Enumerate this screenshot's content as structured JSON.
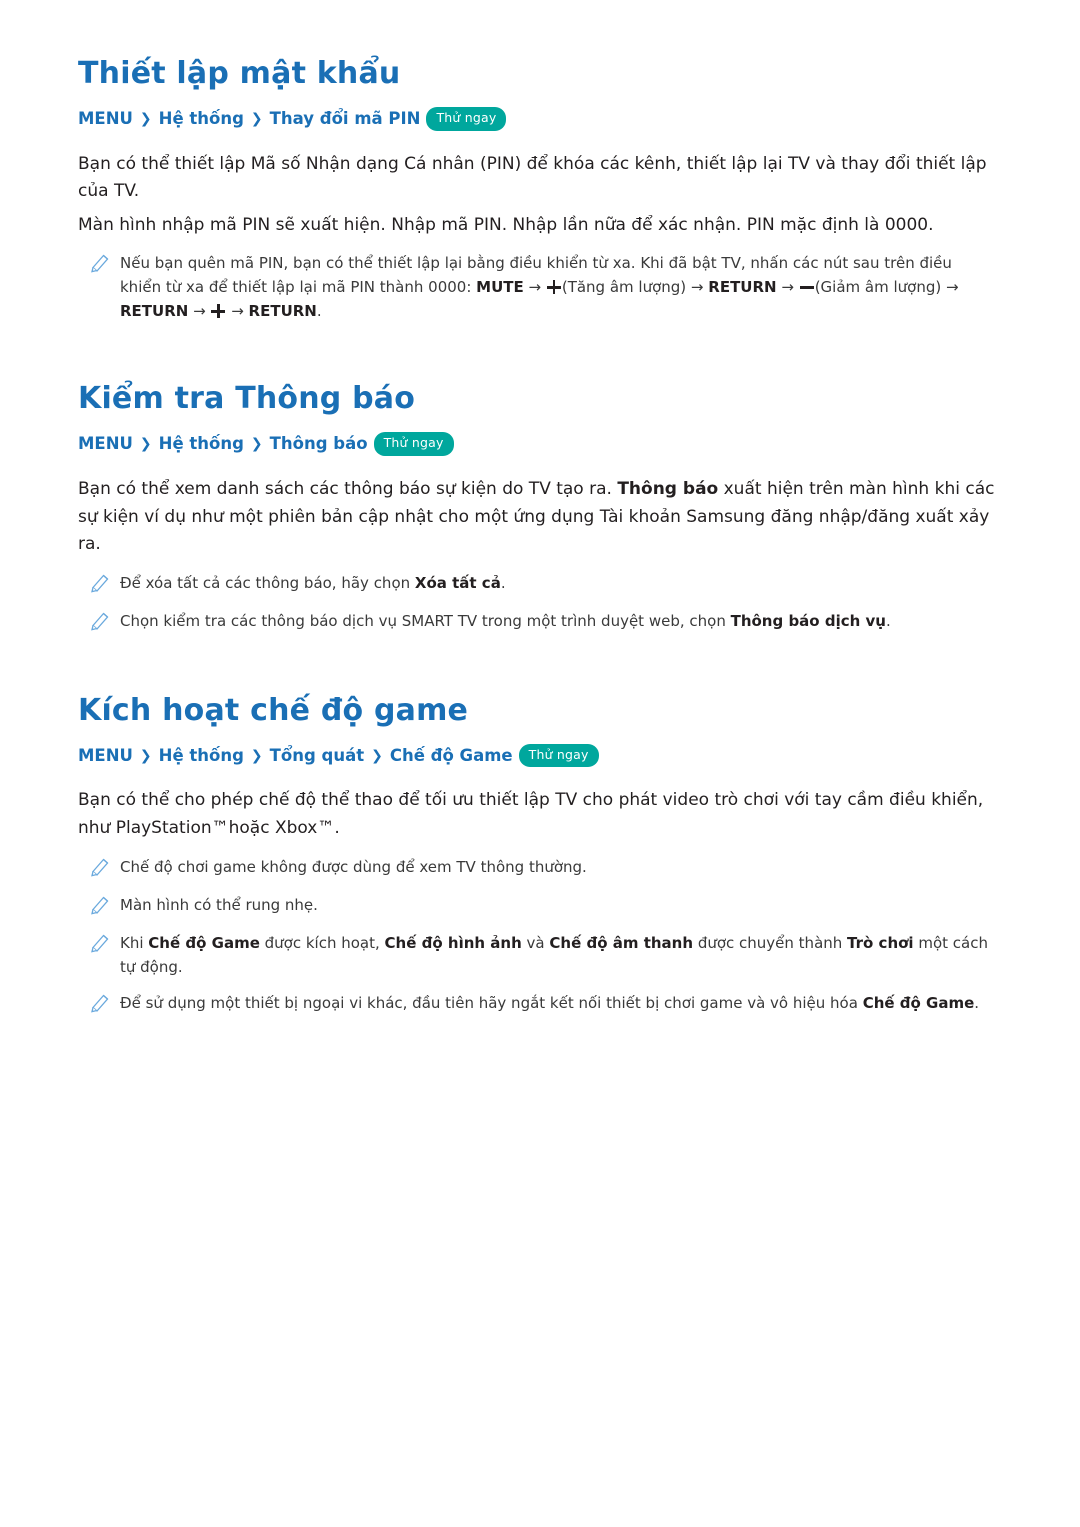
{
  "sections": [
    {
      "title": "Thiết lập mật khẩu",
      "breadcrumb": {
        "root": "MENU",
        "items": [
          "Hệ thống",
          "Thay đổi mã PIN"
        ],
        "try_now": "Thử ngay"
      },
      "paragraphs": [
        "Bạn có thể thiết lập Mã số Nhận dạng Cá nhân (PIN) để khóa các kênh, thiết lập lại TV và thay đổi thiết lập của TV.",
        "Màn hình nhập mã PIN sẽ xuất hiện. Nhập mã PIN. Nhập lần nữa để xác nhận. PIN mặc định là 0000."
      ],
      "notes": [
        {
          "parts": [
            {
              "t": "Nếu bạn quên mã PIN, bạn có thể thiết lập lại bằng điều khiển từ xa. Khi đã bật TV, nhấn các nút sau trên điều khiển từ xa để thiết lập lại mã PIN thành 0000: ",
              "b": false
            },
            {
              "t": "MUTE",
              "b": true
            },
            {
              "t": " → ",
              "b": false
            },
            {
              "t": "PLUS_ICON",
              "icon": "plus-icon"
            },
            {
              "t": "(Tăng âm lượng) → ",
              "b": false
            },
            {
              "t": "RETURN",
              "b": true
            },
            {
              "t": " → ",
              "b": false
            },
            {
              "t": "MINUS_ICON",
              "icon": "minus-icon"
            },
            {
              "t": "(Giảm âm lượng) → ",
              "b": false
            },
            {
              "t": "RETURN",
              "b": true
            },
            {
              "t": " → ",
              "b": false
            },
            {
              "t": "PLUS_ICON",
              "icon": "plus-icon"
            },
            {
              "t": " → ",
              "b": false
            },
            {
              "t": "RETURN",
              "b": true
            },
            {
              "t": ".",
              "b": false
            }
          ]
        }
      ]
    },
    {
      "title": "Kiểm tra Thông báo",
      "breadcrumb": {
        "root": "MENU",
        "items": [
          "Hệ thống",
          "Thông báo"
        ],
        "try_now": "Thử ngay"
      },
      "paragraphs_rich": [
        [
          {
            "t": "Bạn có thể xem danh sách các thông báo sự kiện do TV tạo ra. ",
            "b": false
          },
          {
            "t": "Thông báo",
            "b": true
          },
          {
            "t": " xuất hiện trên màn hình khi các sự kiện ví dụ như một phiên bản cập nhật cho một ứng dụng Tài khoản Samsung đăng nhập/đăng xuất xảy ra.",
            "b": false
          }
        ]
      ],
      "notes": [
        {
          "parts": [
            {
              "t": "Để xóa tất cả các thông báo, hãy chọn ",
              "b": false
            },
            {
              "t": "Xóa tất cả",
              "b": true
            },
            {
              "t": ".",
              "b": false
            }
          ]
        },
        {
          "parts": [
            {
              "t": "Chọn kiểm tra các thông báo dịch vụ SMART TV trong một trình duyệt web, chọn ",
              "b": false
            },
            {
              "t": "Thông báo dịch vụ",
              "b": true
            },
            {
              "t": ".",
              "b": false
            }
          ]
        }
      ]
    },
    {
      "title": "Kích hoạt chế độ game",
      "breadcrumb": {
        "root": "MENU",
        "items": [
          "Hệ thống",
          "Tổng quát",
          "Chế độ Game"
        ],
        "try_now": "Thử ngay"
      },
      "paragraphs": [
        "Bạn có thể cho phép chế độ thể thao để tối ưu thiết lập TV cho phát video trò chơi với tay cầm điều khiển, như PlayStation™hoặc Xbox™."
      ],
      "notes": [
        {
          "parts": [
            {
              "t": "Chế độ chơi game không được dùng để xem TV thông thường.",
              "b": false
            }
          ]
        },
        {
          "parts": [
            {
              "t": "Màn hình có thể rung nhẹ.",
              "b": false
            }
          ]
        },
        {
          "parts": [
            {
              "t": "Khi ",
              "b": false
            },
            {
              "t": "Chế độ Game",
              "b": true
            },
            {
              "t": " được kích hoạt, ",
              "b": false
            },
            {
              "t": "Chế độ hình ảnh",
              "b": true
            },
            {
              "t": " và ",
              "b": false
            },
            {
              "t": "Chế độ âm thanh",
              "b": true
            },
            {
              "t": " được chuyển thành ",
              "b": false
            },
            {
              "t": "Trò chơi",
              "b": true
            },
            {
              "t": " một cách tự động.",
              "b": false
            }
          ]
        },
        {
          "parts": [
            {
              "t": "Để sử dụng một thiết bị ngoại vi khác, đầu tiên hãy ngắt kết nối thiết bị chơi game và vô hiệu hóa ",
              "b": false
            },
            {
              "t": "Chế độ Game",
              "b": true
            },
            {
              "t": ".",
              "b": false
            }
          ]
        }
      ]
    }
  ],
  "colors": {
    "heading": "#1a6fb5",
    "try_now_bg": "#00a79d",
    "body": "#231f20"
  }
}
